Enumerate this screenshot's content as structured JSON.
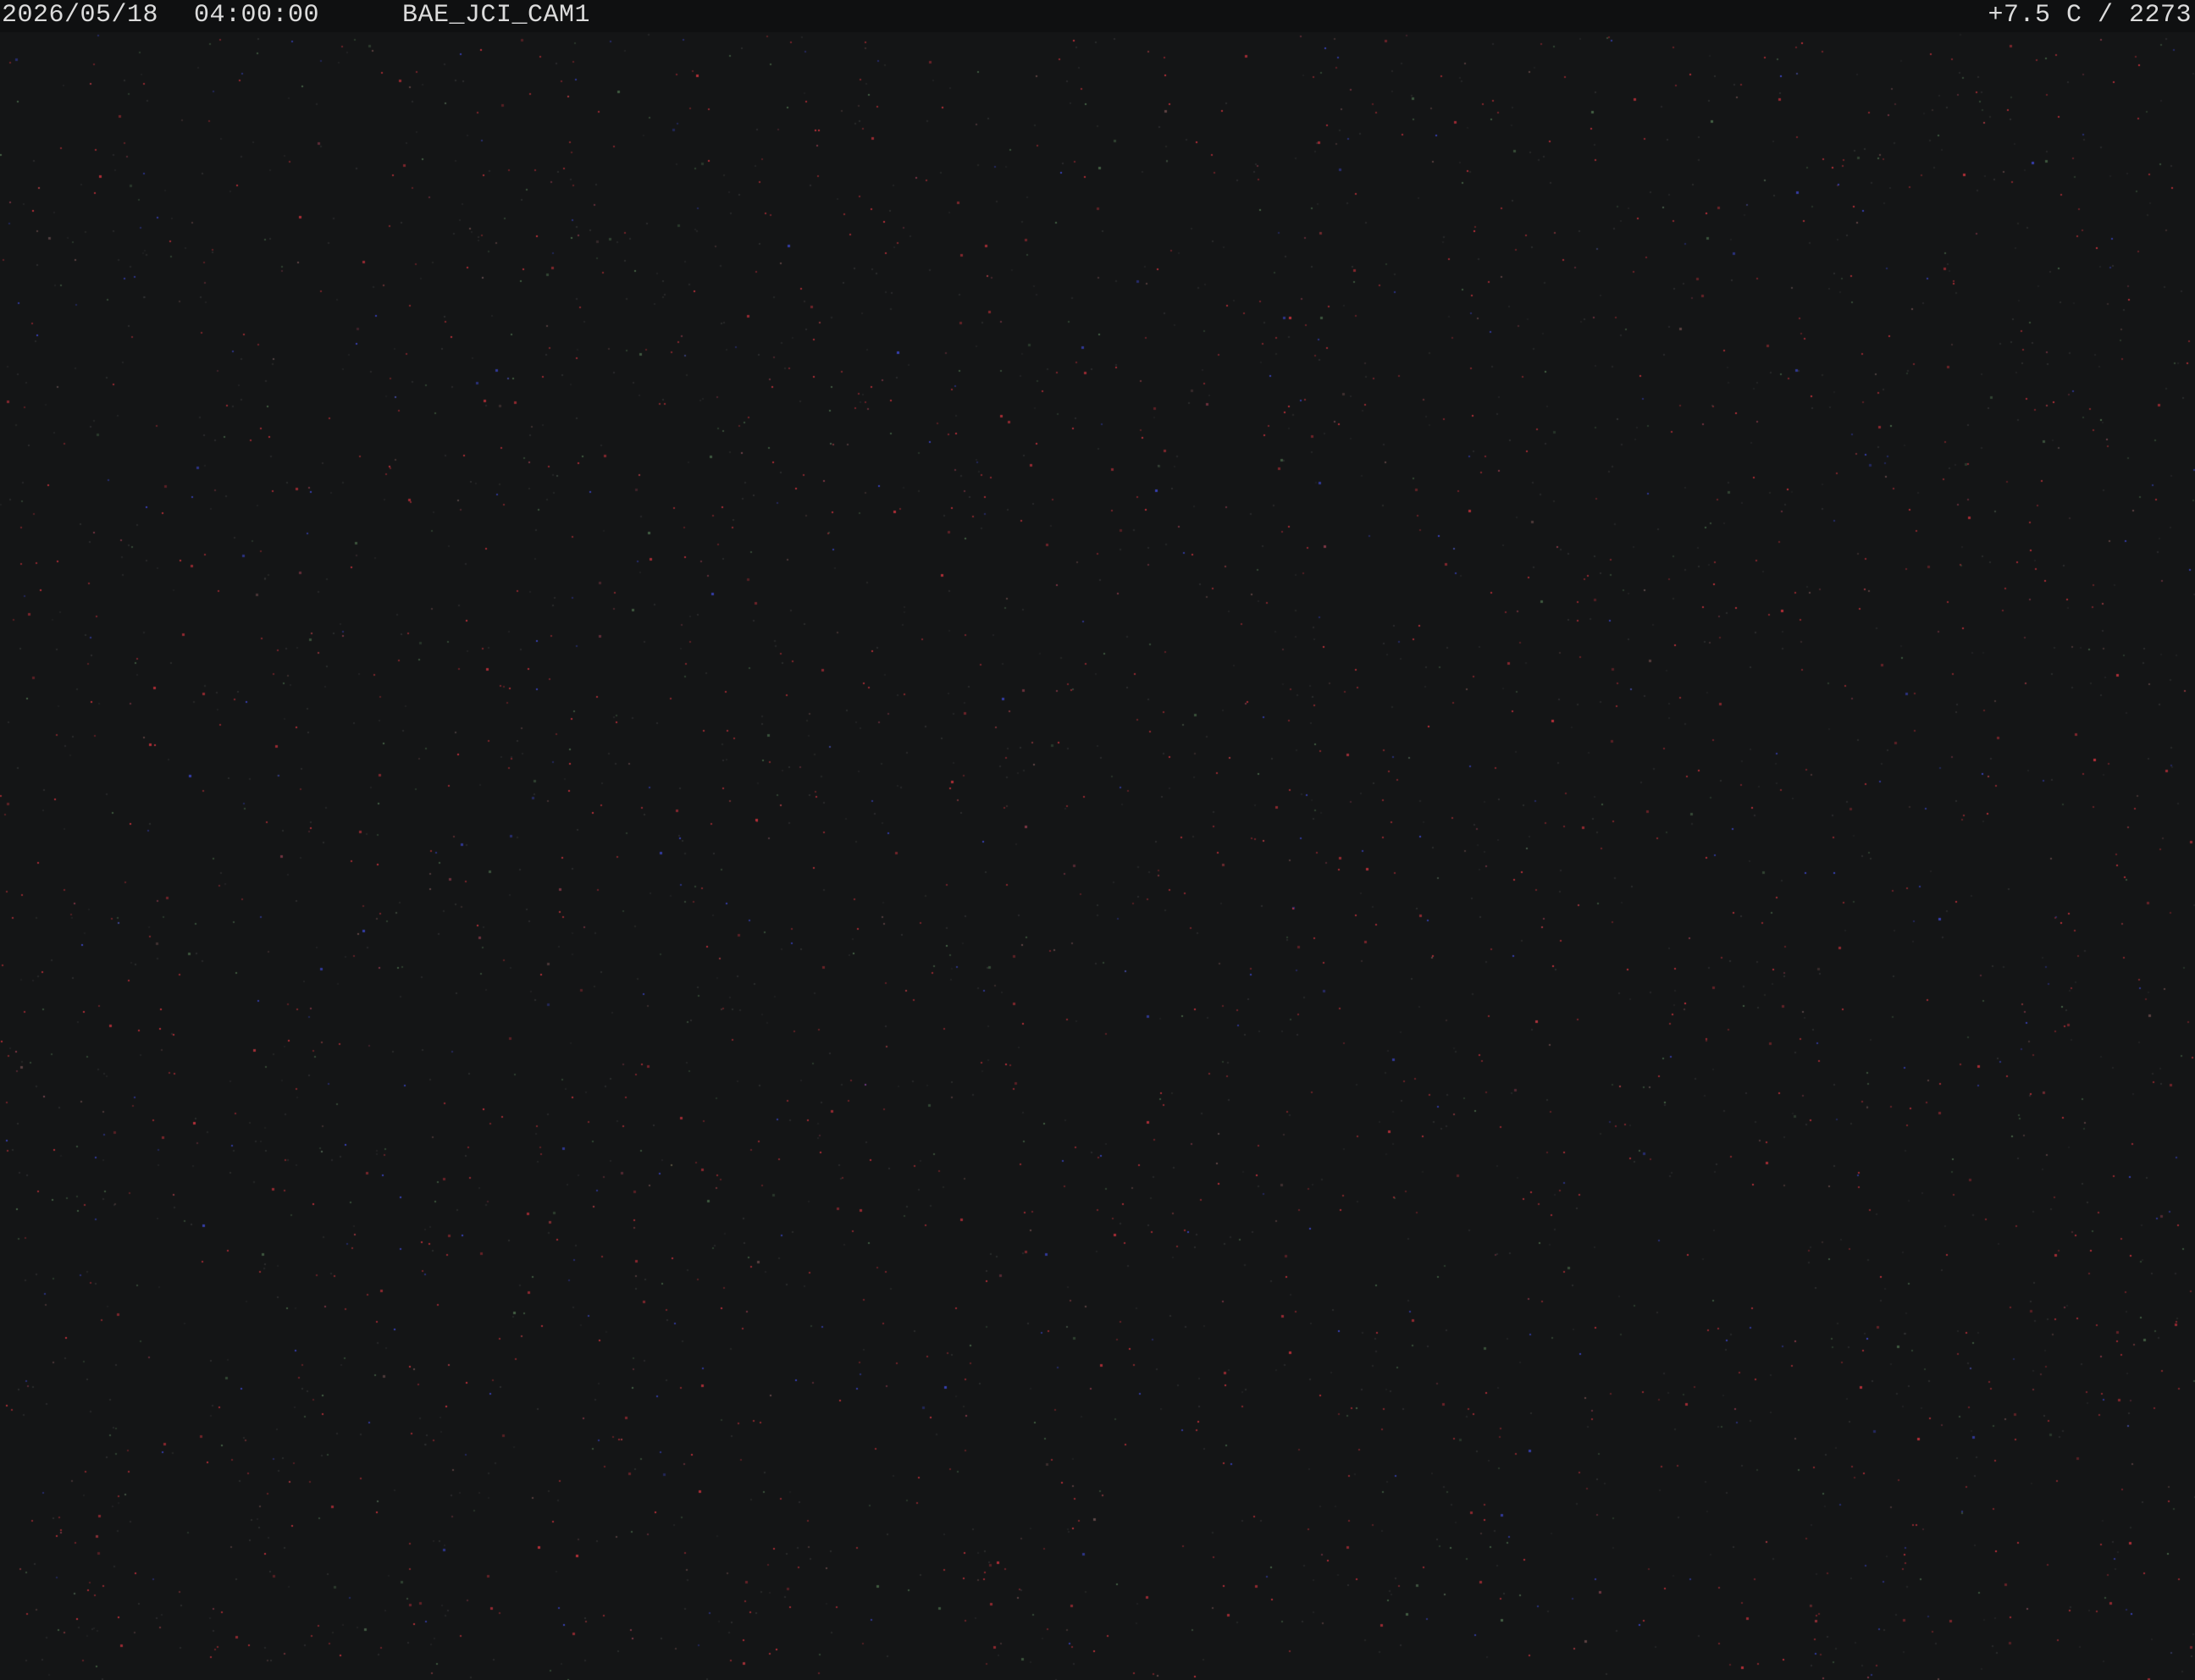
{
  "osd": {
    "date": "2026/05/18",
    "time": "04:00:00",
    "camera_name": "BAE_JCI_CAM1",
    "status": "+7.5 C / 2273"
  },
  "colors": {
    "background": "#141516",
    "osd_bar": "#0f1011",
    "osd_text": "#dcdcdc",
    "noise_red": "#c8323c",
    "noise_blue": "#3c46c8",
    "noise_green": "#4a6a4a"
  }
}
